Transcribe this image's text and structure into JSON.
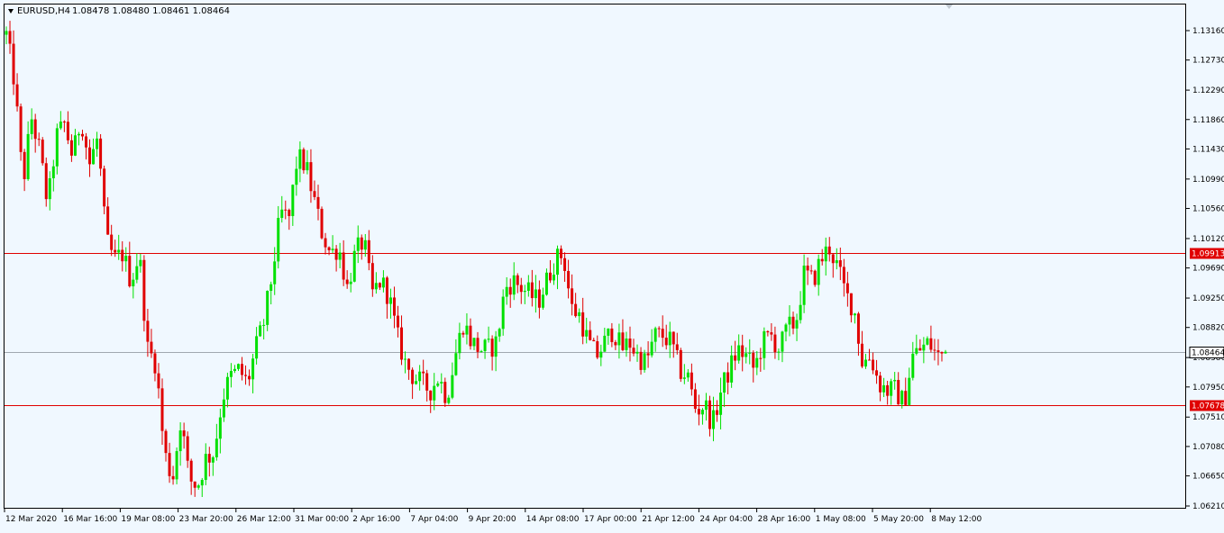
{
  "header": {
    "symbol": "EURUSD,H4",
    "ohlc": "1.08478 1.08480 1.08461 1.08464"
  },
  "chart_data": {
    "type": "candlestick",
    "symbol": "EURUSD",
    "timeframe": "H4",
    "ylim": [
      1.0621,
      1.1316
    ],
    "y_ticks": [
      "1.13160",
      "1.12730",
      "1.12290",
      "1.11860",
      "1.11430",
      "1.10990",
      "1.10560",
      "1.10120",
      "1.09690",
      "1.09250",
      "1.08820",
      "1.08380",
      "1.07950",
      "1.07510",
      "1.07080",
      "1.06650",
      "1.06210"
    ],
    "x_ticks": [
      "12 Mar 2020",
      "16 Mar 16:00",
      "19 Mar 08:00",
      "23 Mar 20:00",
      "26 Mar 12:00",
      "31 Mar 00:00",
      "2 Apr 16:00",
      "7 Apr 04:00",
      "9 Apr 20:00",
      "14 Apr 08:00",
      "17 Apr 00:00",
      "21 Apr 12:00",
      "24 Apr 04:00",
      "28 Apr 16:00",
      "1 May 08:00",
      "5 May 20:00",
      "8 May 12:00"
    ],
    "horizontal_lines": [
      {
        "label": "1.09913",
        "value": 1.09913,
        "color": "#e00000"
      },
      {
        "label": "1.07678",
        "value": 1.07678,
        "color": "#e00000"
      }
    ],
    "current_price": {
      "label": "1.08464",
      "value": 1.08464,
      "color": "#a0a8b0"
    },
    "up_color": "#00e000",
    "down_color": "#e00000",
    "close_path": [
      1.131,
      1.124,
      1.109,
      1.119,
      1.114,
      1.106,
      1.116,
      1.118,
      1.113,
      1.119,
      1.112,
      1.116,
      1.101,
      1.098,
      1.099,
      1.095,
      1.099,
      1.085,
      1.083,
      1.07,
      1.066,
      1.075,
      1.066,
      1.065,
      1.069,
      1.07,
      1.078,
      1.081,
      1.082,
      1.08,
      1.085,
      1.089,
      1.096,
      1.105,
      1.104,
      1.113,
      1.112,
      1.107,
      1.102,
      1.099,
      1.1,
      1.094,
      1.099,
      1.101,
      1.093,
      1.095,
      1.093,
      1.087,
      1.083,
      1.081,
      1.08,
      1.079,
      1.081,
      1.078,
      1.084,
      1.089,
      1.086,
      1.085,
      1.085,
      1.086,
      1.094,
      1.095,
      1.094,
      1.093,
      1.092,
      1.095,
      1.098,
      1.099,
      1.091,
      1.09,
      1.086,
      1.084,
      1.086,
      1.088,
      1.085,
      1.086,
      1.084,
      1.083,
      1.087,
      1.087,
      1.086,
      1.082,
      1.081,
      1.076,
      1.077,
      1.074,
      1.079,
      1.082,
      1.085,
      1.084,
      1.082,
      1.086,
      1.087,
      1.085,
      1.088,
      1.089,
      1.096,
      1.095,
      1.098,
      1.1,
      1.097,
      1.093,
      1.091,
      1.083,
      1.084,
      1.08,
      1.079,
      1.079,
      1.077,
      1.084,
      1.085,
      1.086,
      1.084,
      1.0846
    ]
  }
}
